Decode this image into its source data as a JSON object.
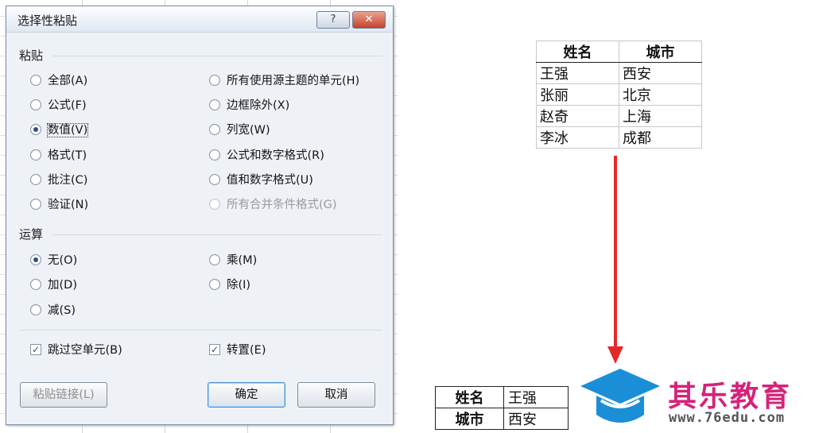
{
  "dialog": {
    "title": "选择性粘贴",
    "help_label": "?",
    "close_label": "✕",
    "paste_section": "粘贴",
    "paste_options": [
      {
        "label": "全部(A)",
        "selected": false,
        "disabled": false
      },
      {
        "label": "公式(F)",
        "selected": false,
        "disabled": false
      },
      {
        "label": "数值(V)",
        "selected": true,
        "disabled": false
      },
      {
        "label": "格式(T)",
        "selected": false,
        "disabled": false
      },
      {
        "label": "批注(C)",
        "selected": false,
        "disabled": false
      },
      {
        "label": "验证(N)",
        "selected": false,
        "disabled": false
      },
      {
        "label": "所有使用源主题的单元(H)",
        "selected": false,
        "disabled": false
      },
      {
        "label": "边框除外(X)",
        "selected": false,
        "disabled": false
      },
      {
        "label": "列宽(W)",
        "selected": false,
        "disabled": false
      },
      {
        "label": "公式和数字格式(R)",
        "selected": false,
        "disabled": false
      },
      {
        "label": "值和数字格式(U)",
        "selected": false,
        "disabled": false
      },
      {
        "label": "所有合并条件格式(G)",
        "selected": false,
        "disabled": true
      }
    ],
    "operation_section": "运算",
    "operation_options": [
      {
        "label": "无(O)",
        "selected": true
      },
      {
        "label": "加(D)",
        "selected": false
      },
      {
        "label": "减(S)",
        "selected": false
      },
      {
        "label": "乘(M)",
        "selected": false
      },
      {
        "label": "除(I)",
        "selected": false
      }
    ],
    "skip_blanks": {
      "label": "跳过空单元(B)",
      "checked": true
    },
    "transpose": {
      "label": "转置(E)",
      "checked": true
    },
    "paste_link_label": "粘贴链接(L)",
    "ok_label": "确定",
    "cancel_label": "取消"
  },
  "source_table": {
    "headers": [
      "姓名",
      "城市"
    ],
    "rows": [
      [
        "王强",
        "西安"
      ],
      [
        "张丽",
        "北京"
      ],
      [
        "赵奇",
        "上海"
      ],
      [
        "李冰",
        "成都"
      ]
    ]
  },
  "result_table": {
    "rows": [
      [
        "姓名",
        "王强"
      ],
      [
        "城市",
        "西安"
      ]
    ]
  },
  "logo": {
    "name": "其乐教育",
    "url": "www.76edu.com",
    "icon": "graduation-cap-icon"
  },
  "colors": {
    "arrow": "#e52929",
    "logo_name": "#d4237a",
    "logo_icon": "#1a8fd8"
  }
}
